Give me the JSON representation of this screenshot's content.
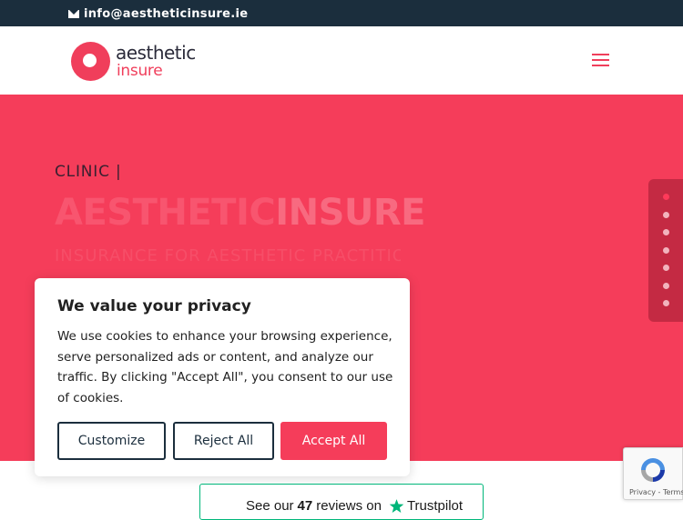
{
  "topbar": {
    "email": "info@aestheticinsure.ie",
    "mail_icon": "envelope-icon"
  },
  "header": {
    "logo_line1": "aesthetic",
    "logo_line2": "insure",
    "menu_icon": "hamburger-menu-icon"
  },
  "hero": {
    "tagline": "CLINIC |",
    "headline_part1": "AESTHETIC",
    "headline_part2": "INSURE",
    "subline": "INSURANCE FOR AESTHETIC PRACTITIONERS",
    "slide_count": 7,
    "active_slide": 1
  },
  "cookie": {
    "title": "We value your privacy",
    "body": "We use cookies to enhance your browsing experience, serve personalized ads or content, and analyze our traffic. By clicking \"Accept All\", you consent to our use of cookies.",
    "customize": "Customize",
    "reject": "Reject All",
    "accept": "Accept All"
  },
  "recaptcha": {
    "legal": "Privacy - Terms"
  },
  "trustpilot": {
    "prefix": "See our",
    "count": "47",
    "suffix": "reviews on",
    "brand": "Trustpilot"
  },
  "colors": {
    "brand": "#f53d5a",
    "navy": "#1b2e3d",
    "trust_green": "#00b67a"
  }
}
